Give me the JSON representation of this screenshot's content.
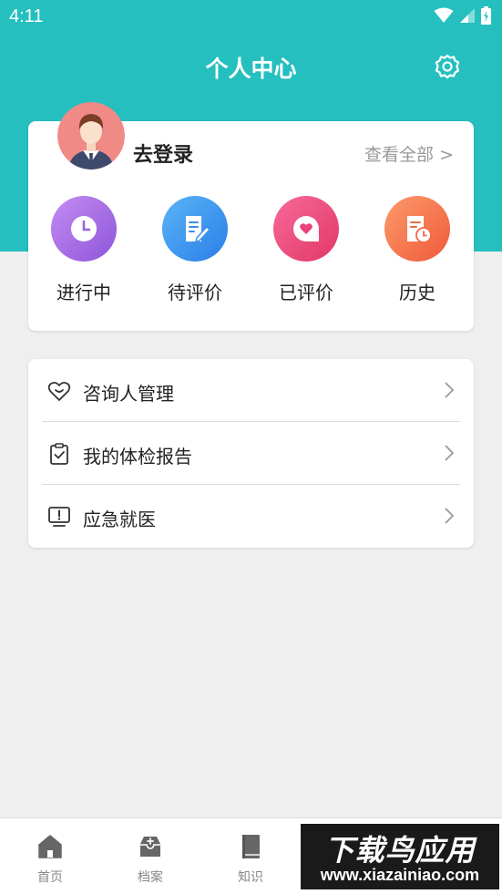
{
  "status_bar": {
    "time": "4:11"
  },
  "header": {
    "title": "个人中心"
  },
  "profile": {
    "login_text": "去登录",
    "view_all": "查看全部 >"
  },
  "orders": [
    {
      "label": "进行中",
      "icon": "clock-icon",
      "colors": [
        "#c48cf2",
        "#8d55d8"
      ]
    },
    {
      "label": "待评价",
      "icon": "edit-document-icon",
      "colors": [
        "#5ab4f6",
        "#2b7ee8"
      ]
    },
    {
      "label": "已评价",
      "icon": "heart-chat-icon",
      "colors": [
        "#f76a9a",
        "#e23766"
      ]
    },
    {
      "label": "历史",
      "icon": "history-document-icon",
      "colors": [
        "#fb9b6b",
        "#f0593a"
      ]
    }
  ],
  "menu": [
    {
      "label": "咨询人管理",
      "icon": "heart-smile-icon"
    },
    {
      "label": "我的体检报告",
      "icon": "clipboard-check-icon"
    },
    {
      "label": "应急就医",
      "icon": "alert-monitor-icon"
    }
  ],
  "tabs": [
    {
      "label": "首页",
      "icon": "home-icon"
    },
    {
      "label": "档案",
      "icon": "archive-icon"
    },
    {
      "label": "知识",
      "icon": "book-icon"
    }
  ],
  "watermark": {
    "title": "下载鸟应用",
    "url": "www.xiazainiao.com"
  },
  "colors": {
    "primary": "#25bfbf",
    "background": "#efefef"
  }
}
